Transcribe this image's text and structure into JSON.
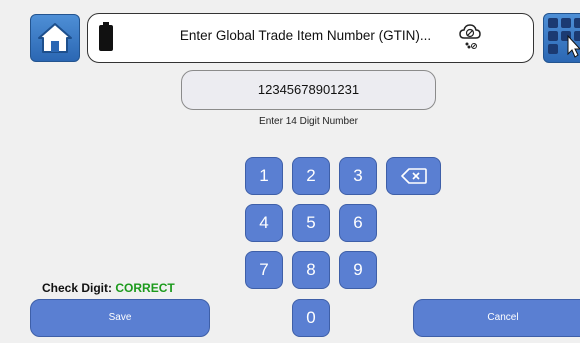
{
  "header": {
    "title": "Enter Global Trade Item Number (GTIN)...",
    "home_icon": "home-icon",
    "battery_icon": "battery-icon",
    "cloud_icon": "cloud-off-icon",
    "grid_icon": "grid-menu-icon"
  },
  "entry": {
    "value": "12345678901231",
    "hint": "Enter 14 Digit Number"
  },
  "keypad": {
    "keys": [
      "1",
      "2",
      "3",
      "4",
      "5",
      "6",
      "7",
      "8",
      "9",
      "0"
    ],
    "backspace_icon": "backspace-icon"
  },
  "status": {
    "label": "Check Digit:",
    "value": "CORRECT",
    "value_color": "#1c9a1c"
  },
  "footer": {
    "save_label": "Save",
    "cancel_label": "Cancel"
  },
  "colors": {
    "accent": "#5a7fd2",
    "header_button": "#3a78c4",
    "background": "#f0f0f0"
  }
}
